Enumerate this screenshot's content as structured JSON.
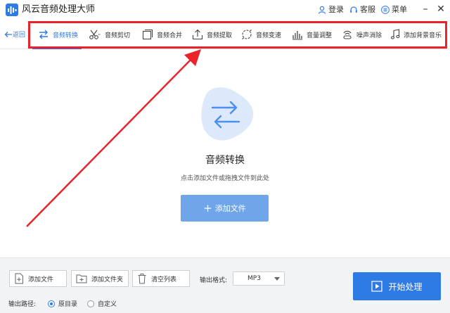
{
  "app": {
    "title": "风云音频处理大师",
    "login_label": "登录",
    "service_label": "客服",
    "menu_label": "菜单",
    "brand_color": "#2f7be5"
  },
  "toolbar": {
    "back_label": "返回",
    "tools": [
      {
        "label": "音频转换",
        "icon": "convert-arrows-icon",
        "active": true
      },
      {
        "label": "音频剪切",
        "icon": "scissors-icon",
        "active": false
      },
      {
        "label": "音频合并",
        "icon": "merge-squares-icon",
        "active": false
      },
      {
        "label": "音频提取",
        "icon": "upload-tray-icon",
        "active": false
      },
      {
        "label": "音频变速",
        "icon": "speed-circle-icon",
        "active": false
      },
      {
        "label": "音量调整",
        "icon": "volume-bars-icon",
        "active": false
      },
      {
        "label": "噪声消除",
        "icon": "noise-waves-icon",
        "active": false
      },
      {
        "label": "添加背景音乐",
        "icon": "music-note-icon",
        "active": false
      }
    ],
    "highlight_color": "#e8232a"
  },
  "main": {
    "title": "音频转换",
    "subtitle": "点击添加文件或拖拽文件到此处",
    "add_button_label": "添加文件"
  },
  "bottom": {
    "add_file_label": "添加文件",
    "add_folder_label": "添加文件夹",
    "clear_list_label": "清空列表",
    "format_label": "输出格式:",
    "format_value": "MP3",
    "start_label": "开始处理",
    "output_path_label": "输出路径:",
    "radio_original": "原目录",
    "radio_custom": "自定义",
    "selected_radio": "原目录"
  }
}
